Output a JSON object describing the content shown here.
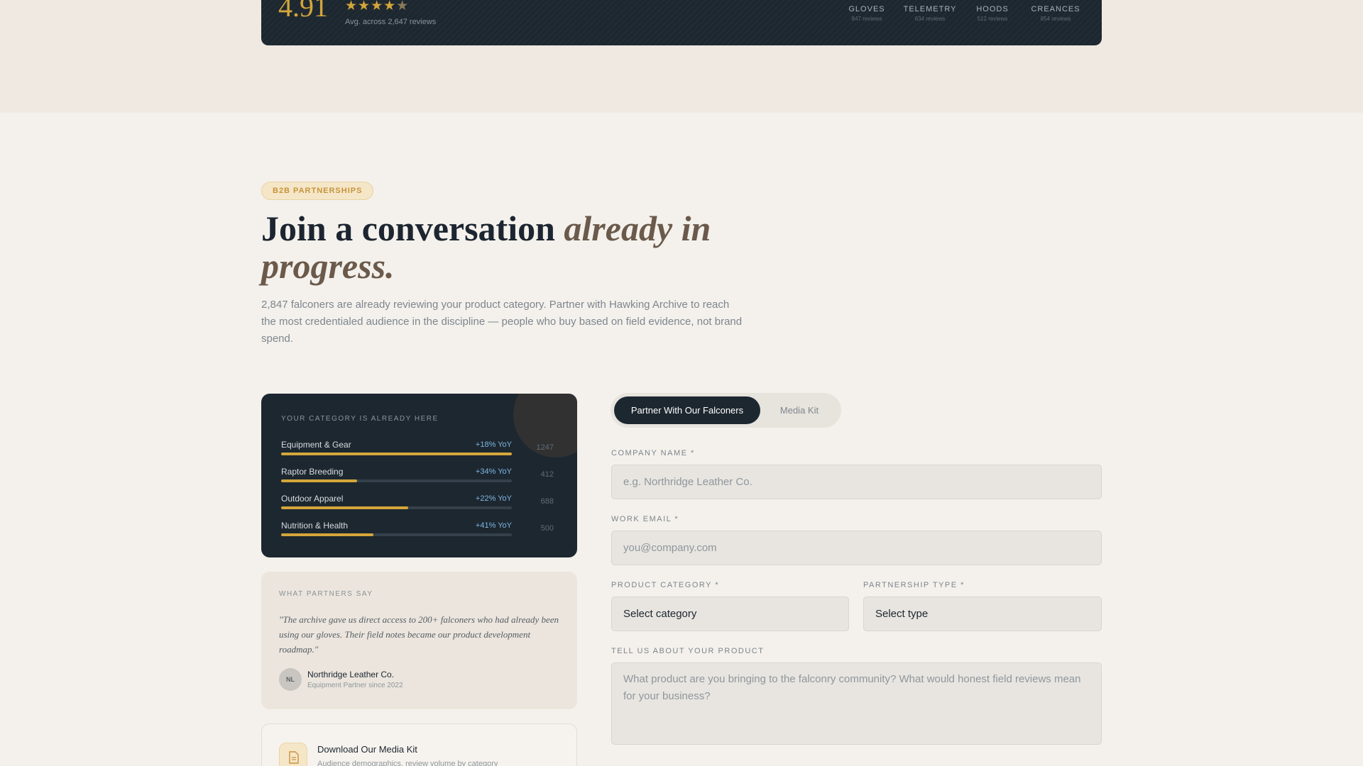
{
  "rating_summary": {
    "avg_score": "4.91",
    "avg_stars": "★★★★",
    "avg_stars_dim": "★",
    "avg_sub": "Avg. across 2,647 reviews",
    "categories": [
      {
        "name": "GLOVES",
        "stars": "★★★★★",
        "count": "847 reviews"
      },
      {
        "name": "TELEMETRY",
        "stars": "★★★★★",
        "count": "634 reviews"
      },
      {
        "name": "HOODS",
        "stars": "★★★★★",
        "count": "512 reviews"
      },
      {
        "name": "CREANCES",
        "stars": "★★★★★",
        "count": "854 reviews"
      }
    ]
  },
  "hero": {
    "badge": "B2B PARTNERSHIPS",
    "headline_plain": "Join a conversation ",
    "headline_italic": "already in progress.",
    "intro": "2,847 falconers are already reviewing your product category. Partner with Hawking Archive to reach the most credentialed audience in the discipline — people who buy based on field evidence, not brand spend."
  },
  "category_stats": {
    "title": "YOUR CATEGORY IS ALREADY HERE",
    "rows": [
      {
        "label": "Equipment & Gear",
        "yoy": "+18% YoY",
        "count": "1247",
        "fill": 1.0
      },
      {
        "label": "Raptor Breeding",
        "yoy": "+34% YoY",
        "count": "412",
        "fill": 0.33
      },
      {
        "label": "Outdoor Apparel",
        "yoy": "+22% YoY",
        "count": "688",
        "fill": 0.55
      },
      {
        "label": "Nutrition & Health",
        "yoy": "+41% YoY",
        "count": "500",
        "fill": 0.4
      }
    ]
  },
  "testimonial": {
    "title": "WHAT PARTNERS SAY",
    "quote": "\"The archive gave us direct access to 200+ falconers who had already been using our gloves. Their field notes became our product development roadmap.\"",
    "avatar_initials": "NL",
    "partner_name": "Northridge Leather Co.",
    "partner_since": "Equipment Partner since 2022"
  },
  "media_kit": {
    "title": "Download Our Media Kit",
    "subtitle": "Audience demographics, review volume by category"
  },
  "form": {
    "tabs": [
      {
        "label": "Partner With Our Falconers",
        "active": true
      },
      {
        "label": "Media Kit",
        "active": false
      }
    ],
    "company_label": "COMPANY NAME *",
    "company_placeholder": "e.g. Northridge Leather Co.",
    "email_label": "WORK EMAIL *",
    "email_placeholder": "you@company.com",
    "category_label": "PRODUCT CATEGORY *",
    "category_value": "Select category",
    "type_label": "PARTNERSHIP TYPE *",
    "type_value": "Select type",
    "product_label": "TELL US ABOUT YOUR PRODUCT",
    "product_placeholder": "What product are you bringing to the falconry community? What would honest field reviews mean for your business?"
  },
  "colors": {
    "accent_gold": "#d4a63a",
    "dark_navy": "#1d2730",
    "page_bg": "#f4f1ec",
    "yoy_blue": "#7fb6e0"
  }
}
